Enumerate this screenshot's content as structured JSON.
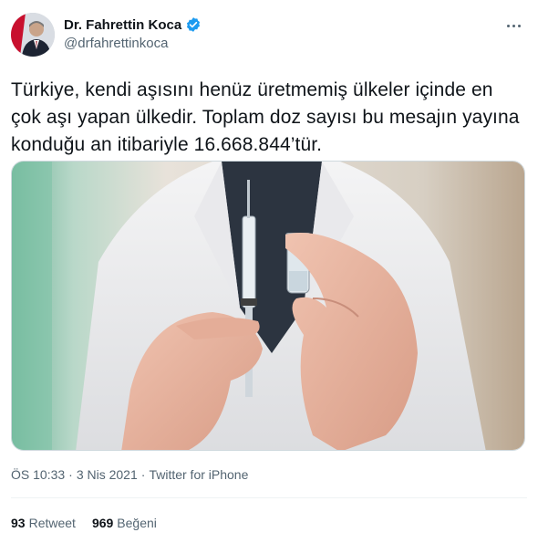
{
  "author": {
    "display_name": "Dr. Fahrettin Koca",
    "handle": "@drfahrettinkoca",
    "verified_icon": "verified-badge-icon",
    "badge_color": "#1d9bf0"
  },
  "tweet": {
    "text": "Türkiye, kendi aşısını henüz üretmemiş ülkeler içinde en çok aşı yapan ülkedir. Toplam doz sayısı bu mesajın yayına konduğu an itibariyle 16.668.844’tür.",
    "media_description_icon": "vaccine-photo"
  },
  "meta": {
    "time": "ÖS 10:33",
    "separator": "·",
    "date": "3 Nis 2021",
    "source": "Twitter for iPhone"
  },
  "stats": {
    "retweets_count": "93",
    "retweets_label": "Retweet",
    "likes_count": "969",
    "likes_label": "Beğeni"
  },
  "colors": {
    "text_primary": "#0f1419",
    "text_secondary": "#536471",
    "divider": "#eff3f4"
  }
}
